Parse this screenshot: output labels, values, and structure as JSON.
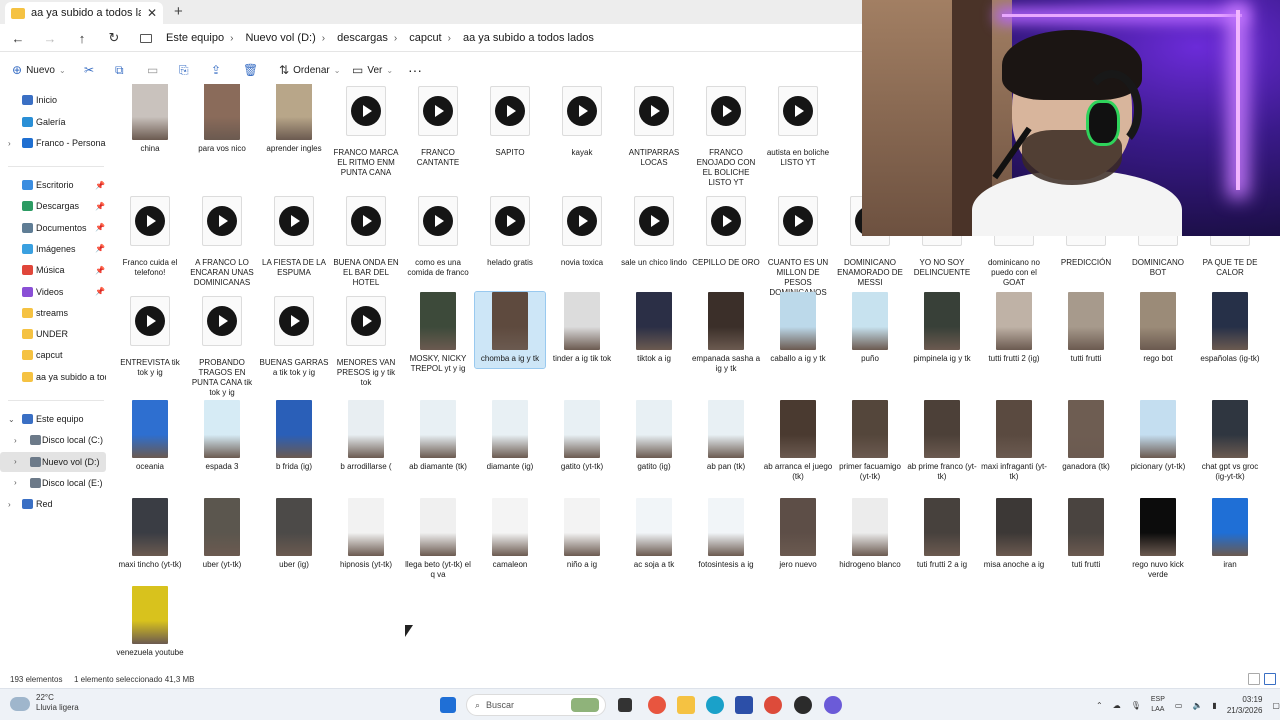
{
  "tab": {
    "title": "aa ya subido a todos lados"
  },
  "breadcrumb": [
    "Este equipo",
    "Nuevo vol (D:)",
    "descargas",
    "capcut",
    "aa ya subido a todos lados"
  ],
  "commands": {
    "new": "Nuevo",
    "sort": "Ordenar",
    "view": "Ver"
  },
  "sidebar": {
    "top": [
      {
        "label": "Inicio",
        "icon": "home-icon",
        "color": "#3a6fc4"
      },
      {
        "label": "Galería",
        "icon": "gallery-icon",
        "color": "#2a8fd6"
      },
      {
        "label": "Franco - Personal",
        "icon": "onedrive-icon",
        "color": "#1f6fd1"
      }
    ],
    "quick": [
      {
        "label": "Escritorio",
        "icon": "desktop-icon",
        "color": "#3b8de0"
      },
      {
        "label": "Descargas",
        "icon": "downloads-icon",
        "color": "#2c9b63"
      },
      {
        "label": "Documentos",
        "icon": "documents-icon",
        "color": "#5f7d95"
      },
      {
        "label": "Imágenes",
        "icon": "pictures-icon",
        "color": "#3aa0e0"
      },
      {
        "label": "Música",
        "icon": "music-icon",
        "color": "#e0463a"
      },
      {
        "label": "Videos",
        "icon": "videos-icon",
        "color": "#8a4fd6"
      },
      {
        "label": "streams",
        "icon": "folder-icon",
        "color": "#f5c242"
      },
      {
        "label": "UNDER",
        "icon": "folder-icon",
        "color": "#f5c242"
      },
      {
        "label": "capcut",
        "icon": "folder-icon",
        "color": "#f5c242"
      },
      {
        "label": "aa ya subido a todc",
        "icon": "folder-icon",
        "color": "#f5c242"
      }
    ],
    "tree": [
      {
        "label": "Este equipo",
        "icon": "pc-icon",
        "color": "#3a6fc4",
        "expanded": true
      },
      {
        "label": "Disco local (C:)",
        "icon": "drive-icon",
        "color": "#6c7a89"
      },
      {
        "label": "Nuevo vol (D:)",
        "icon": "drive-icon",
        "color": "#6c7a89",
        "selected": true
      },
      {
        "label": "Disco local (E:)",
        "icon": "drive-icon",
        "color": "#6c7a89"
      },
      {
        "label": "Red",
        "icon": "network-icon",
        "color": "#3a6fc4"
      }
    ]
  },
  "files": [
    {
      "name": "china",
      "type": "image",
      "color": "#c9c2bd"
    },
    {
      "name": "para vos nico",
      "type": "image",
      "color": "#8a6b5a"
    },
    {
      "name": "aprender ingles",
      "type": "image",
      "color": "#b8a689"
    },
    {
      "name": "FRANCO MARCA EL RITMO ENM PUNTA CANA",
      "type": "video"
    },
    {
      "name": "FRANCO CANTANTE",
      "type": "video"
    },
    {
      "name": "SAPITO",
      "type": "video"
    },
    {
      "name": "kayak",
      "type": "video"
    },
    {
      "name": "ANTIPARRAS LOCAS",
      "type": "video"
    },
    {
      "name": "FRANCO ENOJADO CON EL BOLICHE LISTO YT",
      "type": "video"
    },
    {
      "name": "autista en boliche LISTO YT",
      "type": "video"
    },
    {
      "name": "Franco cuida el telefono!",
      "type": "video"
    },
    {
      "name": "A FRANCO LO ENCARAN UNAS DOMINICANAS",
      "type": "video"
    },
    {
      "name": "LA FIESTA DE LA ESPUMA",
      "type": "video"
    },
    {
      "name": "BUENA ONDA EN EL BAR DEL HOTEL",
      "type": "video"
    },
    {
      "name": "como es una comida de franco",
      "type": "video"
    },
    {
      "name": "helado gratis",
      "type": "video"
    },
    {
      "name": "novia toxica",
      "type": "video"
    },
    {
      "name": "sale un chico lindo",
      "type": "video"
    },
    {
      "name": "CEPILLO DE ORO",
      "type": "video"
    },
    {
      "name": "CUANTO ES UN MILLON DE PESOS DOMINICANOS",
      "type": "video"
    },
    {
      "name": "DOMINICANO ENAMORADO DE MESSI",
      "type": "video"
    },
    {
      "name": "YO NO SOY DELINCUENTE",
      "type": "video"
    },
    {
      "name": "dominicano no puedo con el GOAT",
      "type": "video"
    },
    {
      "name": "PREDICCIÓN",
      "type": "video"
    },
    {
      "name": "DOMINICANO BOT",
      "type": "video"
    },
    {
      "name": "PA QUE TE DE CALOR",
      "type": "video"
    },
    {
      "name": "ENTREVISTA tik tok y ig",
      "type": "video"
    },
    {
      "name": "PROBANDO TRAGOS EN PUNTA CANA tik tok y ig",
      "type": "video"
    },
    {
      "name": "BUENAS GARRAS a tik tok y ig",
      "type": "video"
    },
    {
      "name": "MENORES VAN PRESOS ig y tik tok",
      "type": "video"
    },
    {
      "name": "MOSKY, NICKY TREPOL yt y ig",
      "type": "image",
      "color": "#3d4a3a"
    },
    {
      "name": "chomba a ig y tk",
      "type": "image",
      "color": "#5e4a3e",
      "selected": true
    },
    {
      "name": "tinder a ig tik tok",
      "type": "image",
      "color": "#dcdcdc"
    },
    {
      "name": "tiktok a ig",
      "type": "image",
      "color": "#2b2f46"
    },
    {
      "name": "empanada sasha a ig y tk",
      "type": "image",
      "color": "#3b2f29"
    },
    {
      "name": "caballo a ig y tk",
      "type": "image",
      "color": "#bcd9ea"
    },
    {
      "name": "puño",
      "type": "image",
      "color": "#c7e2ef"
    },
    {
      "name": "pimpinela ig y tk",
      "type": "image",
      "color": "#384038"
    },
    {
      "name": "tutti frutti 2 (ig)",
      "type": "image",
      "color": "#bfb2a6"
    },
    {
      "name": "tutti frutti",
      "type": "image",
      "color": "#a79a8c"
    },
    {
      "name": "rego bot",
      "type": "image",
      "color": "#9b8b78"
    },
    {
      "name": "españolas (ig-tk)",
      "type": "image",
      "color": "#263048"
    },
    {
      "name": "oceania",
      "type": "image",
      "color": "#2e6fd0"
    },
    {
      "name": "espada 3",
      "type": "image",
      "color": "#d6ebf5"
    },
    {
      "name": "b frida (ig)",
      "type": "image",
      "color": "#2a5fb8"
    },
    {
      "name": "b arrodillarse (",
      "type": "image",
      "color": "#e8eef2"
    },
    {
      "name": "ab diamante (tk)",
      "type": "image",
      "color": "#e8f0f4"
    },
    {
      "name": "diamante (ig)",
      "type": "image",
      "color": "#e8f0f4"
    },
    {
      "name": "gatito (yt-tk)",
      "type": "image",
      "color": "#e8f0f4"
    },
    {
      "name": "gatito (ig)",
      "type": "image",
      "color": "#e8f0f4"
    },
    {
      "name": "ab pan (tk)",
      "type": "image",
      "color": "#e8f0f4"
    },
    {
      "name": "ab arranca el juego (tk)",
      "type": "image",
      "color": "#4a3a30"
    },
    {
      "name": "primer facuamigo (yt-tk)",
      "type": "image",
      "color": "#54463b"
    },
    {
      "name": "ab prime franco (yt-tk)",
      "type": "image",
      "color": "#4c4038"
    },
    {
      "name": "maxi infraganti (yt-tk)",
      "type": "image",
      "color": "#5a4a40"
    },
    {
      "name": "ganadora (tk)",
      "type": "image",
      "color": "#6e5d52"
    },
    {
      "name": "picionary (yt-tk)",
      "type": "image",
      "color": "#c4def0"
    },
    {
      "name": "chat gpt vs groc (ig-yt-tk)",
      "type": "image",
      "color": "#2f3640"
    },
    {
      "name": "maxi tincho (yt-tk)",
      "type": "image",
      "color": "#3a3d44"
    },
    {
      "name": "uber (yt-tk)",
      "type": "image",
      "color": "#5b564e"
    },
    {
      "name": "uber (ig)",
      "type": "image",
      "color": "#4c4a48"
    },
    {
      "name": "hipnosis (yt-tk)",
      "type": "image",
      "color": "#f2f2f2"
    },
    {
      "name": "llega beto (yt-tk) el q va",
      "type": "image",
      "color": "#f0f0f0"
    },
    {
      "name": "camaleon",
      "type": "image",
      "color": "#f4f4f4"
    },
    {
      "name": "niño a ig",
      "type": "image",
      "color": "#f3f3f3"
    },
    {
      "name": "ac soja a tk",
      "type": "image",
      "color": "#f1f5f8"
    },
    {
      "name": "fotosintesis a ig",
      "type": "image",
      "color": "#f1f5f8"
    },
    {
      "name": "jero nuevo",
      "type": "image",
      "color": "#5d4e47"
    },
    {
      "name": "hidrogeno blanco",
      "type": "image",
      "color": "#ececec"
    },
    {
      "name": "tuti frutti 2 a ig",
      "type": "image",
      "color": "#47413d"
    },
    {
      "name": "misa anoche a ig",
      "type": "image",
      "color": "#3c3836"
    },
    {
      "name": "tuti frutti",
      "type": "image",
      "color": "#4a4440"
    },
    {
      "name": "rego nuvo kick verde",
      "type": "image",
      "color": "#0c0c0c"
    },
    {
      "name": "iran",
      "type": "image",
      "color": "#1f6fd6"
    },
    {
      "name": "venezuela youtube",
      "type": "image",
      "color": "#d8c21d"
    }
  ],
  "status": {
    "count": "193 elementos",
    "selection": "1 elemento seleccionado  41,3 MB"
  },
  "taskbar": {
    "weather_temp": "22°C",
    "weather_desc": "Lluvia ligera",
    "search_placeholder": "Buscar",
    "lang_top": "ESP",
    "lang_bottom": "LAA",
    "time": "03:19",
    "date": "21/3/2026"
  }
}
